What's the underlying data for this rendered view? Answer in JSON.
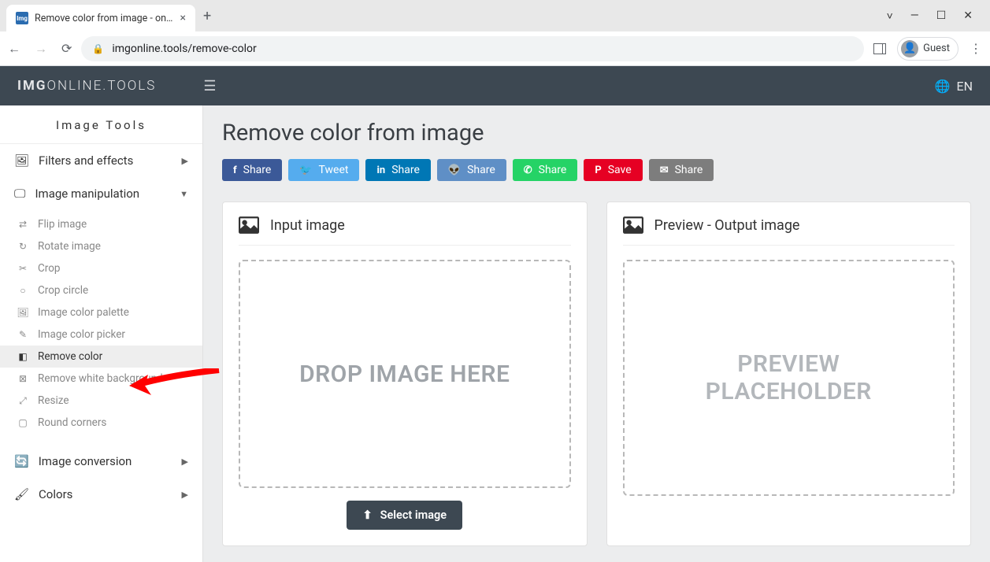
{
  "browser": {
    "tab_title": "Remove color from image - onlin",
    "url": "imgonline.tools/remove-color",
    "guest_label": "Guest"
  },
  "header": {
    "logo_bold": "IMG",
    "logo_rest": "ONLINE.TOOLS",
    "language": "EN"
  },
  "sidebar": {
    "title": "Image Tools",
    "categories": [
      {
        "label": "Filters and effects",
        "expanded": false
      },
      {
        "label": "Image manipulation",
        "expanded": true
      },
      {
        "label": "Image conversion",
        "expanded": false
      },
      {
        "label": "Colors",
        "expanded": false
      }
    ],
    "manipulation_items": [
      {
        "label": "Flip image"
      },
      {
        "label": "Rotate image"
      },
      {
        "label": "Crop"
      },
      {
        "label": "Crop circle"
      },
      {
        "label": "Image color palette"
      },
      {
        "label": "Image color picker"
      },
      {
        "label": "Remove color",
        "active": true
      },
      {
        "label": "Remove white background"
      },
      {
        "label": "Resize"
      },
      {
        "label": "Round corners"
      }
    ]
  },
  "page": {
    "title": "Remove color from image",
    "share_buttons": [
      {
        "label": "Share",
        "net": "facebook"
      },
      {
        "label": "Tweet",
        "net": "twitter"
      },
      {
        "label": "Share",
        "net": "linkedin"
      },
      {
        "label": "Share",
        "net": "reddit"
      },
      {
        "label": "Share",
        "net": "whatsapp"
      },
      {
        "label": "Save",
        "net": "pinterest"
      },
      {
        "label": "Share",
        "net": "email"
      }
    ],
    "input_panel": {
      "title": "Input image",
      "drop_text": "DROP IMAGE HERE",
      "select_button": "Select image"
    },
    "preview_panel": {
      "title": "Preview - Output image",
      "placeholder_line1": "PREVIEW",
      "placeholder_line2": "PLACEHOLDER"
    }
  }
}
